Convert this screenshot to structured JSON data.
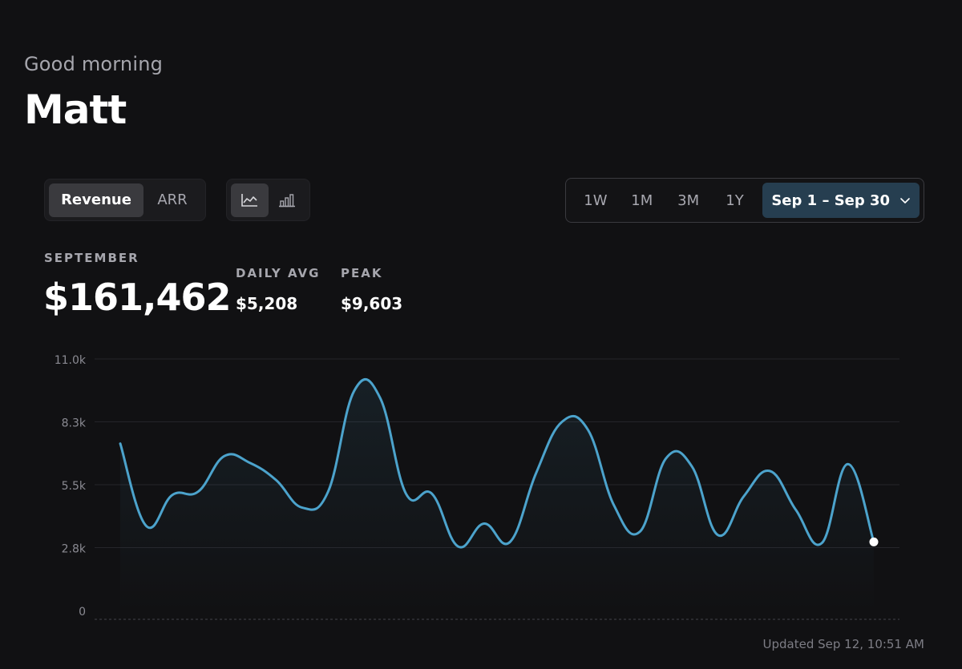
{
  "header": {
    "greeting": "Good morning",
    "name": "Matt"
  },
  "metric_toggle": {
    "options": [
      "Revenue",
      "ARR"
    ],
    "selected": "Revenue"
  },
  "chart_type_toggle": {
    "options": [
      "line-chart-icon",
      "bar-chart-icon"
    ],
    "selected": "line-chart-icon"
  },
  "range": {
    "options": [
      "1W",
      "1M",
      "3M",
      "1Y"
    ],
    "date_label": "Sep 1 – Sep 30",
    "dropdown_icon": "chevron-down-icon"
  },
  "stats": {
    "period_label": "SEPTEMBER",
    "total": "$161,462",
    "daily_avg_label": "DAILY AVG",
    "daily_avg": "$5,208",
    "peak_label": "PEAK",
    "peak": "$9,603"
  },
  "colors": {
    "background": "#111113",
    "line": "#4ca3cc",
    "accent_selected": "#263e50"
  },
  "chart_data": {
    "type": "area",
    "x": [
      1,
      2,
      3,
      4,
      5,
      6,
      7,
      8,
      9,
      10,
      11,
      12,
      13,
      14,
      15,
      16,
      17,
      18,
      19,
      20,
      21,
      22,
      23,
      24,
      25,
      26,
      27,
      28,
      29,
      30
    ],
    "values": [
      7300,
      3700,
      5050,
      5200,
      6750,
      6450,
      5700,
      4500,
      5200,
      9600,
      9300,
      5100,
      5100,
      2800,
      3800,
      3000,
      6000,
      8250,
      7900,
      4600,
      3450,
      6650,
      6300,
      3300,
      5000,
      6100,
      4400,
      2950,
      6400,
      3000
    ],
    "y_ticks": [
      "11.0k",
      "8.3k",
      "5.5k",
      "2.8k",
      "0"
    ],
    "ylim": [
      0,
      11000
    ],
    "grid": true,
    "highlight_last_point": true
  },
  "footer": {
    "updated": "Updated Sep 12, 10:51 AM"
  }
}
